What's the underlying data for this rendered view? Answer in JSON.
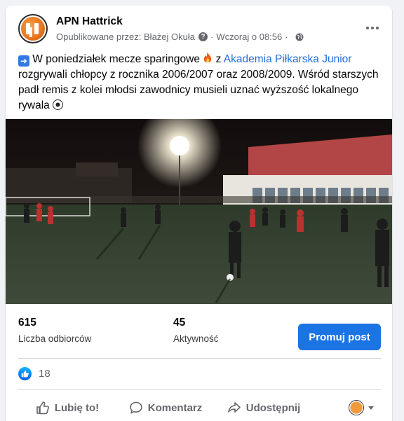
{
  "post": {
    "page_name": "APN Hattrick",
    "published_by": "Opublikowane przez: Błażej Okuła",
    "time": "Wczoraj o 08:56",
    "text_part1": " W poniedziałek mecze sparingowe ",
    "text_part2": " z ",
    "mention": "Akademia Piłkarska Junior",
    "text_part3": " rozgrywali chłopcy z rocznika 2006/2007 oraz 2008/2009. Wśród starszych padł remis z kolei młodsi zawodnicy musieli uznać wyższość lokalnego rywala ",
    "icons": [
      "arrow-right-emoji",
      "fire-emoji",
      "soccer-ball-emoji",
      "question-icon",
      "globe-icon"
    ]
  },
  "stats": {
    "reach_value": "615",
    "reach_label": "Liczba odbiorców",
    "engagement_value": "45",
    "engagement_label": "Aktywność",
    "promote_label": "Promuj post"
  },
  "reactions": {
    "count": "18"
  },
  "actions": {
    "like": "Lubię to!",
    "comment": "Komentarz",
    "share": "Udostępnij"
  },
  "colors": {
    "primary": "#1b74e4",
    "link": "#216fdb",
    "secondary_text": "#65676b"
  }
}
